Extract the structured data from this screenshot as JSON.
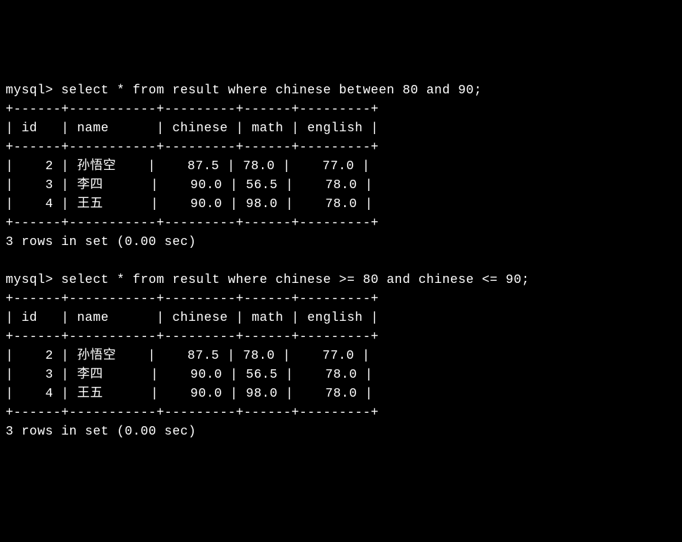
{
  "chart_data": [
    {
      "type": "table",
      "title": "Query 1 Result",
      "query": "select * from result where chinese between 80 and 90;",
      "columns": [
        "id",
        "name",
        "chinese",
        "math",
        "english"
      ],
      "rows": [
        {
          "id": 2,
          "name": "孙悟空",
          "chinese": 87.5,
          "math": 78.0,
          "english": 77.0
        },
        {
          "id": 3,
          "name": "李四",
          "chinese": 90.0,
          "math": 56.5,
          "english": 78.0
        },
        {
          "id": 4,
          "name": "王五",
          "chinese": 90.0,
          "math": 98.0,
          "english": 78.0
        }
      ],
      "status": "3 rows in set (0.00 sec)"
    },
    {
      "type": "table",
      "title": "Query 2 Result",
      "query": "select * from result where chinese >= 80 and chinese <= 90;",
      "columns": [
        "id",
        "name",
        "chinese",
        "math",
        "english"
      ],
      "rows": [
        {
          "id": 2,
          "name": "孙悟空",
          "chinese": 87.5,
          "math": 78.0,
          "english": 77.0
        },
        {
          "id": 3,
          "name": "李四",
          "chinese": 90.0,
          "math": 56.5,
          "english": 78.0
        },
        {
          "id": 4,
          "name": "王五",
          "chinese": 90.0,
          "math": 98.0,
          "english": 78.0
        }
      ],
      "status": "3 rows in set (0.00 sec)"
    }
  ],
  "prompt": "mysql> ",
  "queries": [
    {
      "sql": "select * from result where chinese between 80 and 90;",
      "border_top": "+------+-----------+---------+------+---------+",
      "header": "| id   | name      | chinese | math | english |",
      "rows": [
        "|    2 | 孙悟空    |    87.5 | 78.0 |    77.0 |",
        "|    3 | 李四      |    90.0 | 56.5 |    78.0 |",
        "|    4 | 王五      |    90.0 | 98.0 |    78.0 |"
      ],
      "status": "3 rows in set (0.00 sec)"
    },
    {
      "sql": "select * from result where chinese >= 80 and chinese <= 90;",
      "border_top": "+------+-----------+---------+------+---------+",
      "header": "| id   | name      | chinese | math | english |",
      "rows": [
        "|    2 | 孙悟空    |    87.5 | 78.0 |    77.0 |",
        "|    3 | 李四      |    90.0 | 56.5 |    78.0 |",
        "|    4 | 王五      |    90.0 | 98.0 |    78.0 |"
      ],
      "status": "3 rows in set (0.00 sec)"
    }
  ]
}
